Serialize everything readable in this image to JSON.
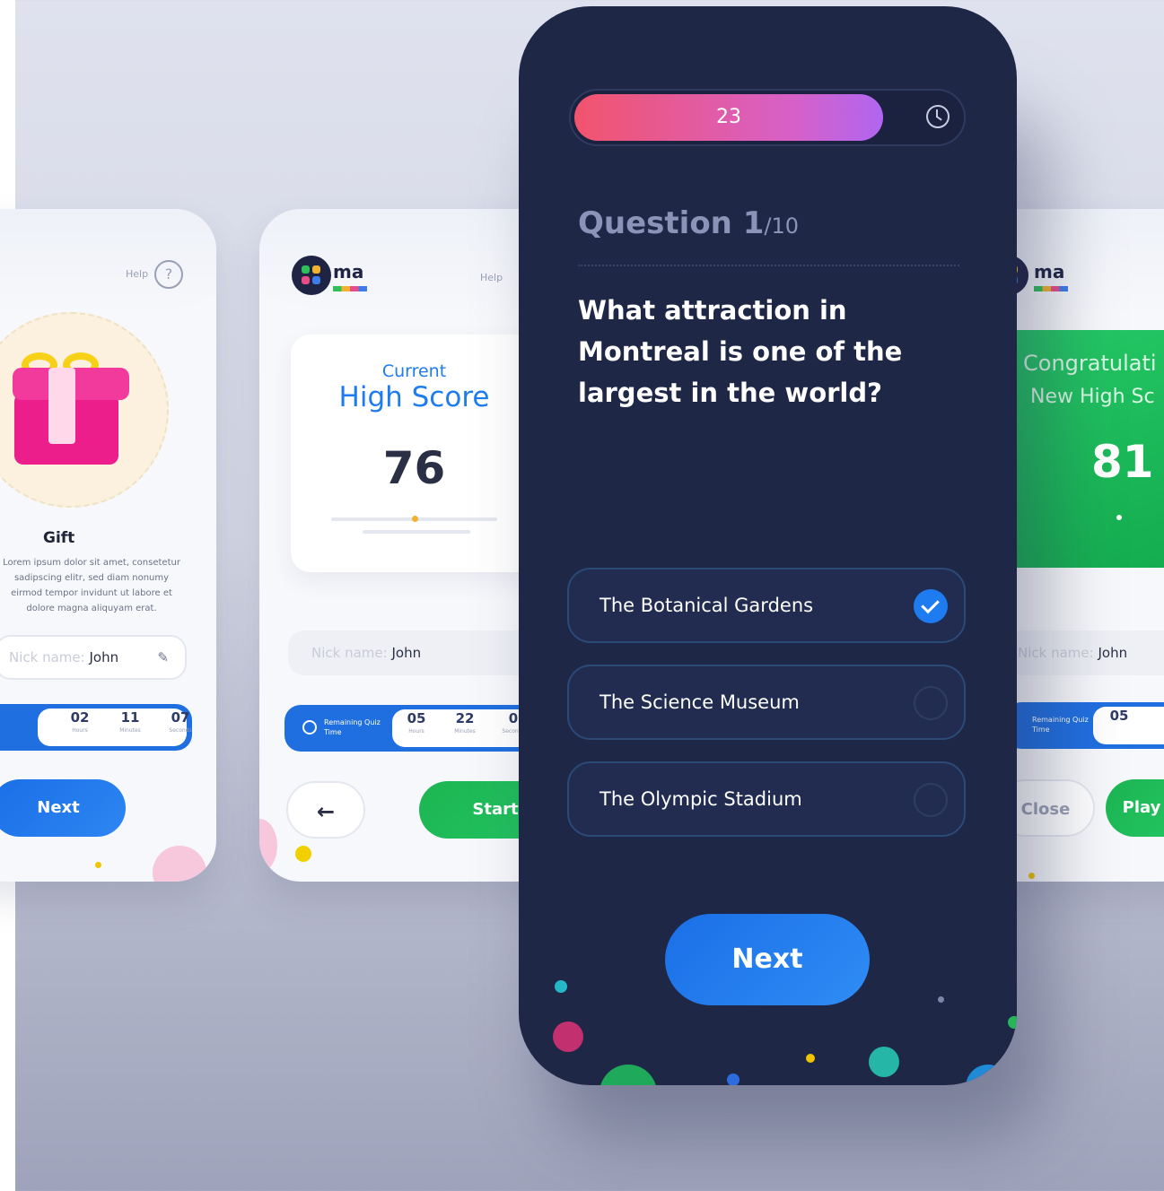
{
  "gift_card": {
    "help_label": "Help",
    "help_icon": "?",
    "title": "Gift",
    "description": "Lorem ipsum dolor sit amet, consetetur sadipscing elitr, sed diam nonumy eirmod tempor invidunt ut labore et dolore magna aliquyam erat.",
    "nick_label": "Nick name:",
    "nick_value": "John",
    "timer": [
      {
        "value": "02",
        "unit": "Hours"
      },
      {
        "value": "11",
        "unit": "Minutes"
      },
      {
        "value": "07",
        "unit": "Seconds"
      }
    ],
    "next_label": "Next"
  },
  "score_card": {
    "logo_text": "ma",
    "help_label": "Help",
    "score_caption": "Current",
    "score_title": "High Score",
    "score_value": "76",
    "nick_label": "Nick name:",
    "nick_value": "John",
    "remaining_label": "Remaining Quiz Time",
    "timer": [
      {
        "value": "05",
        "unit": "Hours"
      },
      {
        "value": "22",
        "unit": "Minutes"
      },
      {
        "value": "0",
        "unit": "Seconds"
      }
    ],
    "back_icon": "←",
    "start_label": "Start"
  },
  "quiz": {
    "timer_value": "23",
    "timer_progress": 0.8,
    "question_label": "Question 1",
    "question_total": "/10",
    "question_text": "What attraction in Montreal is one of the largest in the world?",
    "options": [
      {
        "label": "The Botanical Gardens",
        "selected": true
      },
      {
        "label": "The Science Museum",
        "selected": false
      },
      {
        "label": "The Olympic Stadium",
        "selected": false
      }
    ],
    "next_label": "Next"
  },
  "congrats_card": {
    "logo_text": "ma",
    "title_line1": "Congratulati",
    "title_line2": "New High Sc",
    "score_value": "81",
    "nick_label": "Nick name:",
    "nick_value": "John",
    "remaining_label": "Remaining Quiz Time",
    "timer_first": "05",
    "close_label": "Close",
    "play_label": "Play"
  },
  "colors": {
    "phone_bg": "#1f2746",
    "accent_blue": "#1e7cf0",
    "green": "#1cb552",
    "progress_start": "#f2546d",
    "progress_end": "#b066f0"
  }
}
